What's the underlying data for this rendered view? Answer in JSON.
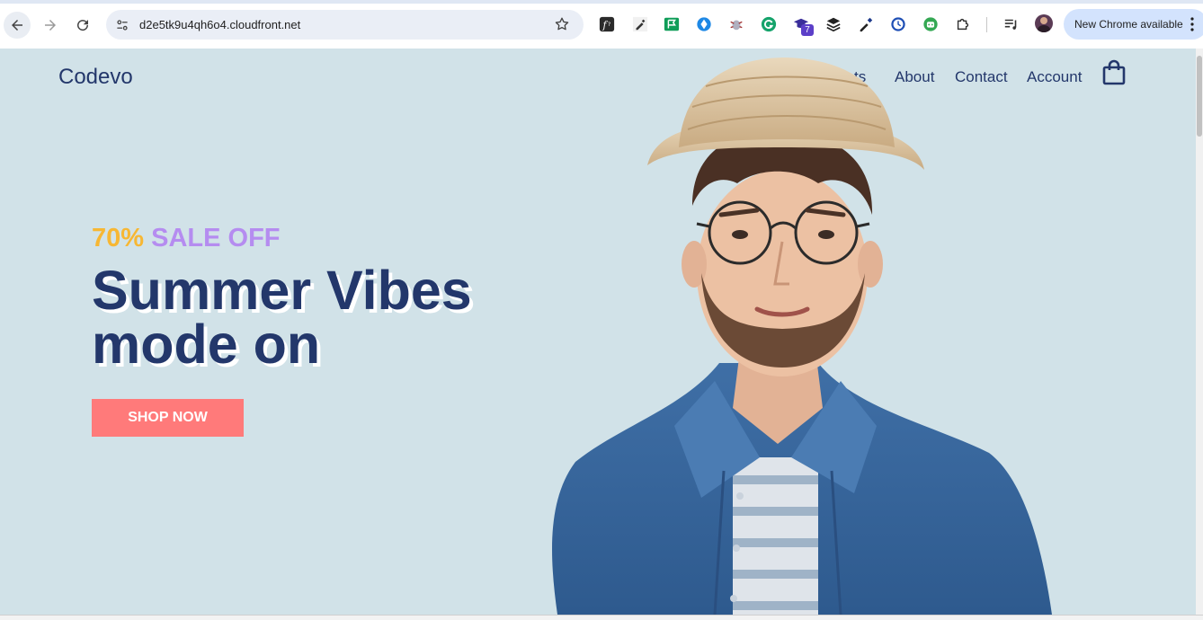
{
  "browser": {
    "url": "d2e5tk9u4qh6o4.cloudfront.net",
    "update_label": "New Chrome available",
    "extensions": [
      "formula-icon",
      "eyedropper-icon",
      "flag-extension-icon",
      "diamond-extension-icon",
      "bug-extension-icon",
      "grammarly-icon",
      "graduation-cap-icon",
      "layers-icon",
      "color-picker-icon",
      "clock-extension-icon",
      "robot-extension-icon",
      "puzzle-icon",
      "media-control-icon"
    ],
    "extension_badge": "7"
  },
  "site": {
    "logo": "Codevo",
    "nav": [
      {
        "label": "ts"
      },
      {
        "label": "About"
      },
      {
        "label": "Contact"
      },
      {
        "label": "Account"
      }
    ]
  },
  "hero": {
    "sale_percent": "70%",
    "sale_text": "SALE OFF",
    "headline_line1": "Summer Vibes",
    "headline_line2": "mode on",
    "cta_label": "SHOP NOW"
  },
  "colors": {
    "page_bg": "#d1e2e8",
    "navy": "#23376b",
    "sale_yellow": "#f7b733",
    "sale_purple": "#b58cf0",
    "cta": "#ff7a7a"
  }
}
